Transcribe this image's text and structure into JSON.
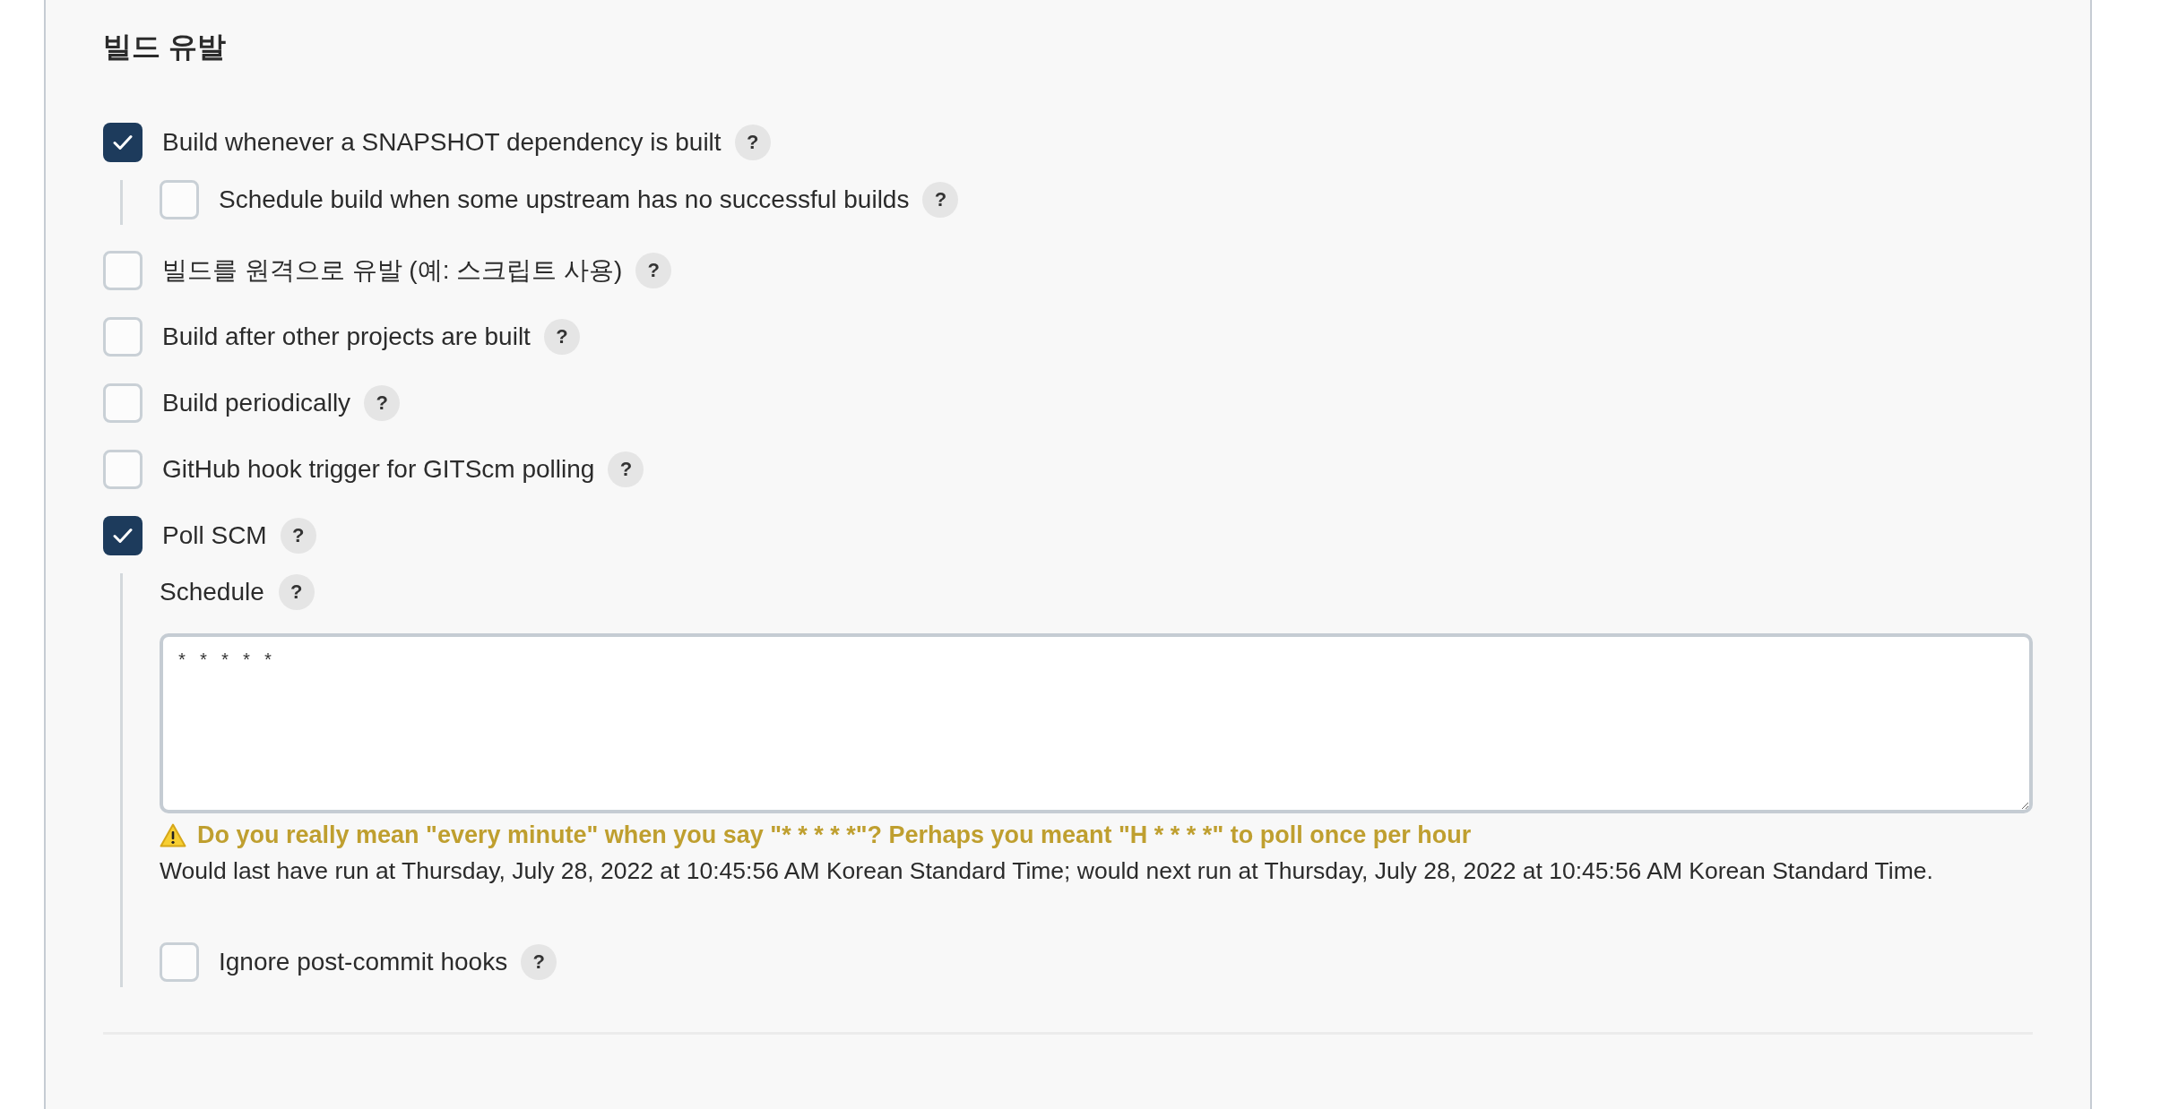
{
  "section": {
    "title": "빌드 유발"
  },
  "triggers": [
    {
      "label": "Build whenever a SNAPSHOT dependency is built",
      "checked": true,
      "help": "?",
      "children": [
        {
          "kind": "checkbox",
          "label": "Schedule build when some upstream has no successful builds",
          "checked": false,
          "help": "?"
        }
      ]
    },
    {
      "label": "빌드를 원격으로 유발 (예: 스크립트 사용)",
      "checked": false,
      "help": "?"
    },
    {
      "label": "Build after other projects are built",
      "checked": false,
      "help": "?"
    },
    {
      "label": "Build periodically",
      "checked": false,
      "help": "?"
    },
    {
      "label": "GitHub hook trigger for GITScm polling",
      "checked": false,
      "help": "?"
    },
    {
      "label": "Poll SCM",
      "checked": true,
      "help": "?",
      "children": [
        {
          "kind": "schedule",
          "label": "Schedule",
          "help": "?",
          "value": "* * * * *",
          "warning": "Do you really mean \"every minute\" when you say \"* * * * *\"? Perhaps you meant \"H * * * *\" to poll once per hour",
          "info": "Would last have run at Thursday, July 28, 2022 at 10:45:56 AM Korean Standard Time; would next run at Thursday, July 28, 2022 at 10:45:56 AM Korean Standard Time."
        },
        {
          "kind": "checkbox",
          "label": "Ignore post-commit hooks",
          "checked": false,
          "help": "?"
        }
      ]
    }
  ]
}
